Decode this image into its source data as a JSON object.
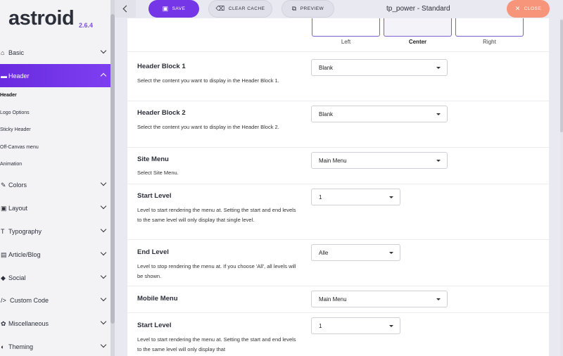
{
  "brand": {
    "logo": "astroid",
    "version": "2.6.4"
  },
  "sidebar": {
    "items": [
      {
        "label": "Basic",
        "icon": "home-icon"
      },
      {
        "label": "Header",
        "icon": "header-icon"
      },
      {
        "label": "Colors",
        "icon": "brush-icon"
      },
      {
        "label": "Layout",
        "icon": "layout-icon"
      },
      {
        "label": "Typography",
        "icon": "typography-icon"
      },
      {
        "label": "Article/Blog",
        "icon": "article-icon"
      },
      {
        "label": "Social",
        "icon": "social-icon"
      },
      {
        "label": "Custom Code",
        "icon": "code-icon"
      },
      {
        "label": "Miscellaneous",
        "icon": "misc-icon"
      },
      {
        "label": "Theming",
        "icon": "theming-icon"
      }
    ],
    "header_sub": [
      "Header",
      "Logo Options",
      "Sticky Header",
      "Off-Canvas menu",
      "Animation"
    ]
  },
  "toolbar": {
    "save": "SAVE",
    "clear_cache": "CLEAR CACHE",
    "preview": "PREVIEW",
    "close": "CLOSE",
    "title": "tp_power - Standard"
  },
  "alignment": {
    "options": [
      "Left",
      "Center",
      "Right"
    ],
    "selected": "Center"
  },
  "fields": [
    {
      "label": "Header Block 1",
      "desc": "Select the content you want to display in the Header Block 1.",
      "value": "Blank"
    },
    {
      "label": "Header Block 2",
      "desc": "Select the content you want to display in the Header Block 2.",
      "value": "Blank"
    },
    {
      "label": "Site Menu",
      "desc": "Select Site Menu.",
      "value": "Main Menu"
    },
    {
      "label": "Start Level",
      "desc": "Level to start rendering the menu at. Setting the start and end levels to the same level will only display that single level.",
      "value": "1"
    },
    {
      "label": "End Level",
      "desc": "Level to stop rendering the menu at. If you choose 'All', all levels will be shown.",
      "value": "Alle"
    },
    {
      "label": "Mobile Menu",
      "desc": "",
      "value": "Main Menu"
    },
    {
      "label": "Start Level",
      "desc": "Level to start rendering the menu at. Setting the start and end levels to the same level will only display that",
      "value": "1"
    }
  ],
  "colors": {
    "accent": "#7436e6",
    "close": "#f7957a"
  }
}
